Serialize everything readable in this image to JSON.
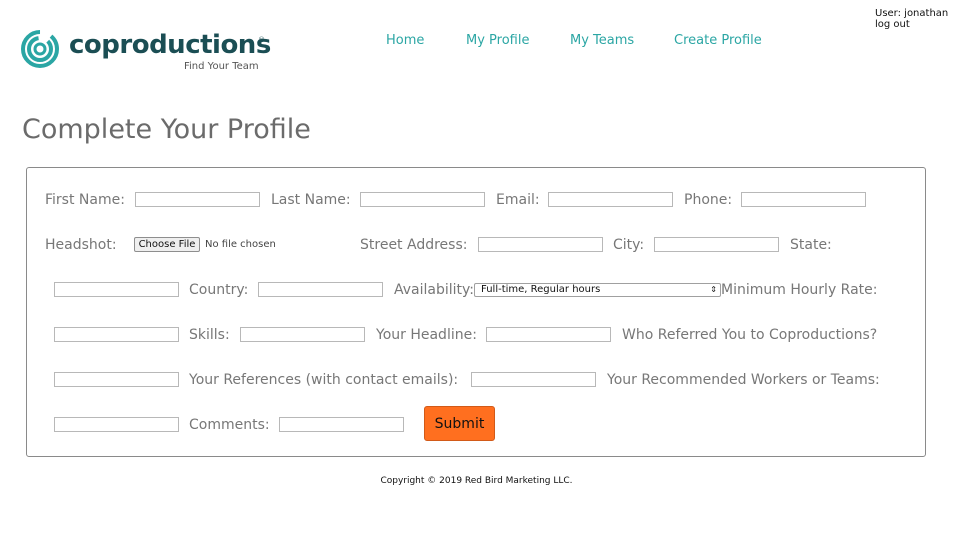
{
  "brand": {
    "name": "coproductions",
    "tagline": "Find Your Team",
    "color": "#2ba6a4",
    "reg_mark": "®"
  },
  "nav": {
    "items": [
      "Home",
      "My Profile",
      "My Teams",
      "Create Profile"
    ]
  },
  "user": {
    "label": "User: jonathan",
    "logout": "log out"
  },
  "page": {
    "title": "Complete Your Profile"
  },
  "form": {
    "first_name_label": "First Name:",
    "last_name_label": "Last Name:",
    "email_label": "Email:",
    "phone_label": "Phone:",
    "headshot_label": "Headshot:",
    "choose_file": "Choose File",
    "no_file": "No file chosen",
    "street_label": "Street Address:",
    "city_label": "City:",
    "state_label": "State:",
    "country_label": "Country:",
    "availability_label": "Availability:",
    "availability_value": "Full-time, Regular hours",
    "min_rate_label": "Minimum Hourly Rate:",
    "skills_label": "Skills:",
    "headline_label": "Your Headline:",
    "referred_label": "Who Referred You to Coproductions?",
    "references_label": "Your References (with contact emails):",
    "recommended_label": "Your Recommended Workers or Teams:",
    "comments_label": "Comments:",
    "submit_label": "Submit",
    "submit_color": "#ff6f1f"
  },
  "footer": {
    "copyright": "Copyright © 2019 Red Bird Marketing LLC."
  }
}
